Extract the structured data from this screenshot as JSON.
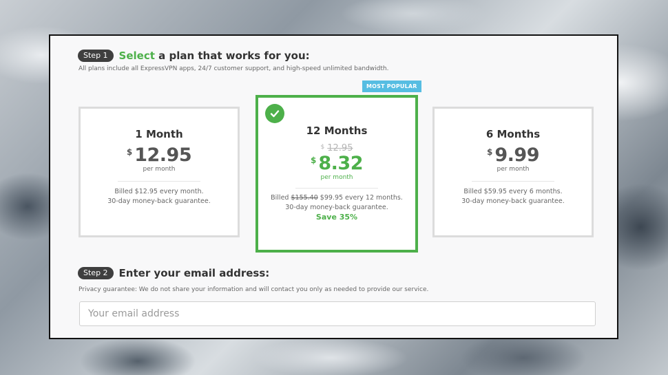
{
  "step1": {
    "pill": "Step 1",
    "title_accent": "Select",
    "title_rest": " a plan that works for you:",
    "subtitle": "All plans include all ExpressVPN apps, 24/7 customer support, and high-speed unlimited bandwidth."
  },
  "badge": "MOST POPULAR",
  "plans": [
    {
      "name": "1 Month",
      "currency": "$",
      "price": "12.95",
      "per": "per month",
      "billing_1": "Billed $12.95 every month.",
      "billing_2": "30-day money-back guarantee."
    },
    {
      "name": "12 Months",
      "currency": "$",
      "old_price": "12.95",
      "price": "8.32",
      "per": "per month",
      "billing_prefix": "Billed ",
      "billing_old": "$155.40",
      "billing_rest": " $99.95 every 12 months.",
      "billing_2": "30-day money-back guarantee.",
      "save": "Save 35%"
    },
    {
      "name": "6 Months",
      "currency": "$",
      "price": "9.99",
      "per": "per month",
      "billing_1": "Billed $59.95 every 6 months.",
      "billing_2": "30-day money-back guarantee."
    }
  ],
  "step2": {
    "pill": "Step 2",
    "title": "Enter your email address:",
    "subtitle": "Privacy guarantee: We do not share your information and will contact you only as needed to provide our service.",
    "placeholder": "Your email address"
  },
  "colors": {
    "accent_green": "#4db04a",
    "badge_blue": "#56bde2",
    "pill_dark": "#3f3f3f"
  },
  "icons": {
    "selected": "check-circle-icon"
  }
}
